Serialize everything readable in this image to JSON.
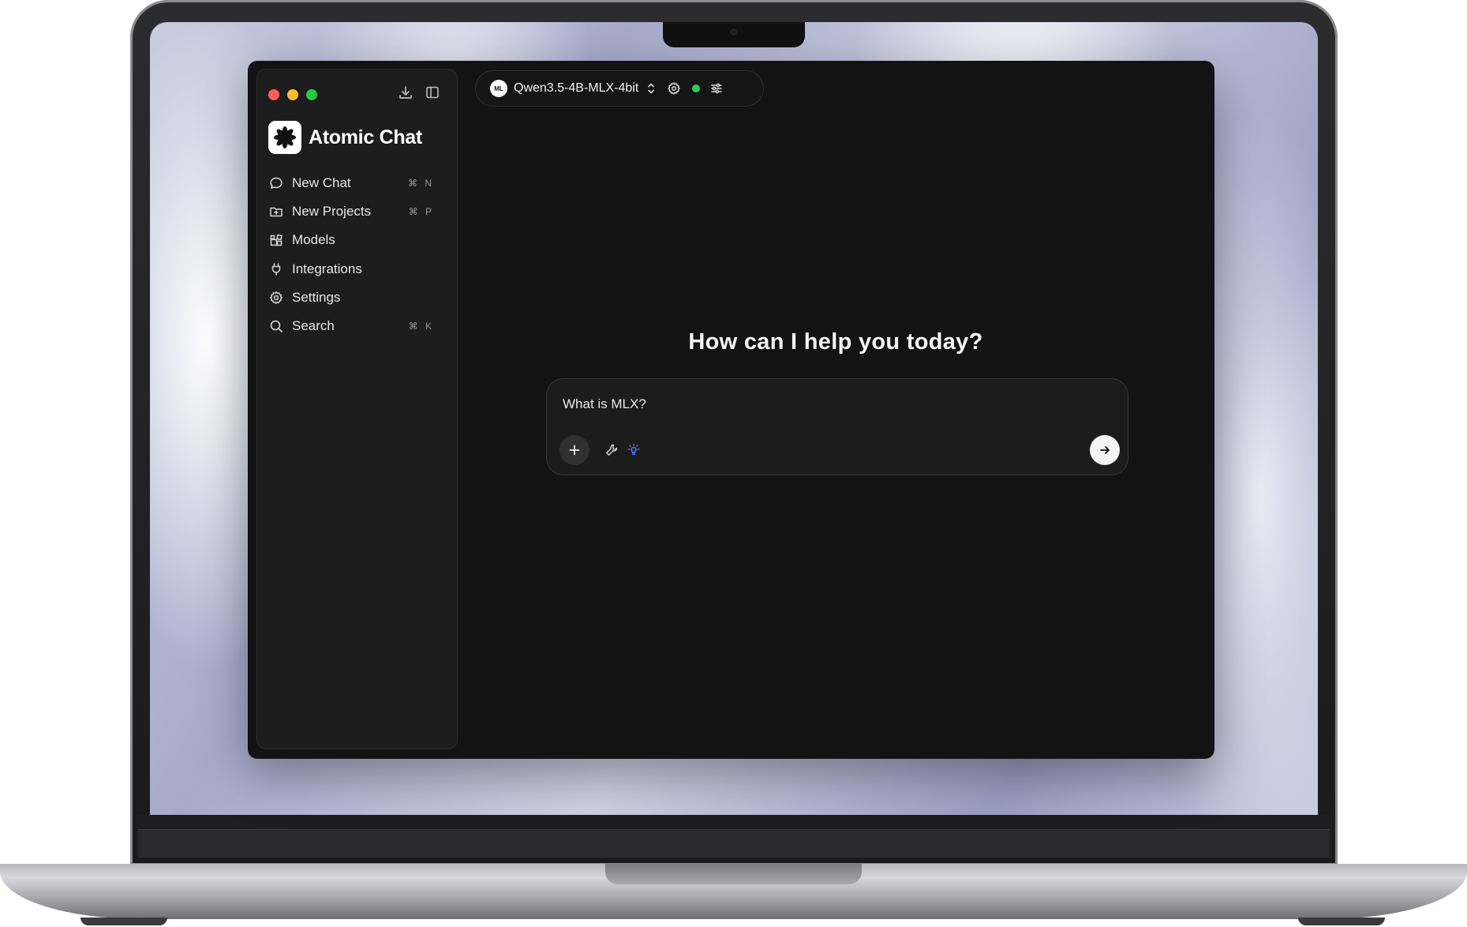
{
  "window": {
    "controls": [
      "close",
      "minimize",
      "zoom"
    ]
  },
  "sidebar": {
    "download_icon": "download-icon",
    "toggle_icon": "sidebar-toggle-icon",
    "brand": {
      "name": "Atomic Chat",
      "logo_icon": "asterisk-flower-icon"
    },
    "items": [
      {
        "label": "New Chat",
        "icon": "chat-bubble-icon",
        "shortcut": "⌘ N"
      },
      {
        "label": "New Projects",
        "icon": "folder-plus-icon",
        "shortcut": "⌘ P"
      },
      {
        "label": "Models",
        "icon": "grid-blocks-icon",
        "shortcut": ""
      },
      {
        "label": "Integrations",
        "icon": "plug-icon",
        "shortcut": ""
      },
      {
        "label": "Settings",
        "icon": "gear-icon",
        "shortcut": ""
      },
      {
        "label": "Search",
        "icon": "search-icon",
        "shortcut": "⌘ K"
      }
    ]
  },
  "header": {
    "provider_badge": "ML",
    "model_name": "Qwen3.5-4B-MLX-4bit",
    "status": "running",
    "status_color": "#2ecc5a"
  },
  "main": {
    "headline": "How can I help you today?",
    "composer": {
      "text": "What is MLX?",
      "tools": [
        "plus-icon",
        "wrench-icon",
        "lightbulb-icon",
        "arrow-right-icon"
      ],
      "lightbulb_color": "#4a7dff"
    }
  }
}
